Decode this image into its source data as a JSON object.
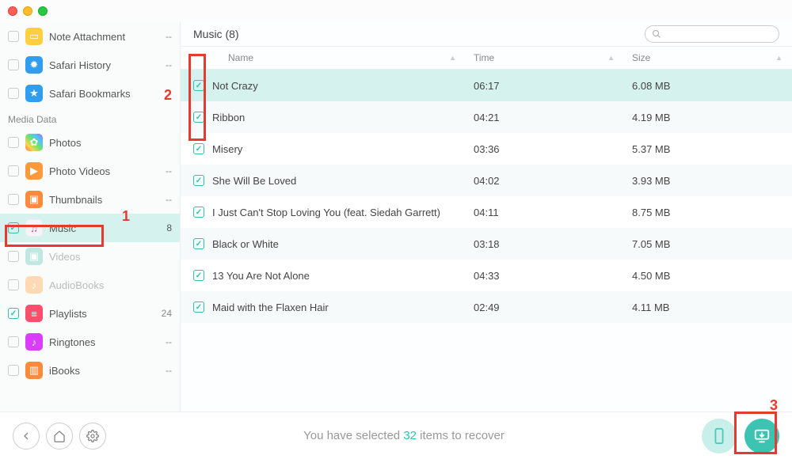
{
  "header": {
    "title": "Music (8)"
  },
  "sidebar": {
    "groups": [
      {
        "label": null,
        "items": [
          {
            "icon": "ic-note",
            "glyph": "▭",
            "label": "Note Attachment",
            "count": "--",
            "checked": false,
            "selected": false,
            "disabled": false
          },
          {
            "icon": "ic-safari",
            "glyph": "✹",
            "label": "Safari History",
            "count": "--",
            "checked": false,
            "selected": false,
            "disabled": false
          },
          {
            "icon": "ic-safari",
            "glyph": "★",
            "label": "Safari Bookmarks",
            "count": "",
            "checked": false,
            "selected": false,
            "disabled": false
          }
        ]
      },
      {
        "label": "Media Data",
        "items": [
          {
            "icon": "ic-photos",
            "glyph": "✿",
            "label": "Photos",
            "count": "",
            "checked": false,
            "selected": false,
            "disabled": false
          },
          {
            "icon": "ic-pvideo",
            "glyph": "▶",
            "label": "Photo Videos",
            "count": "--",
            "checked": false,
            "selected": false,
            "disabled": false
          },
          {
            "icon": "ic-thumb",
            "glyph": "▣",
            "label": "Thumbnails",
            "count": "--",
            "checked": false,
            "selected": false,
            "disabled": false
          },
          {
            "icon": "ic-music",
            "glyph": "♫",
            "label": "Music",
            "count": "8",
            "checked": true,
            "selected": true,
            "disabled": false
          },
          {
            "icon": "ic-videos",
            "glyph": "▣",
            "label": "Videos",
            "count": "",
            "checked": false,
            "selected": false,
            "disabled": true
          },
          {
            "icon": "ic-audio",
            "glyph": "♪",
            "label": "AudioBooks",
            "count": "",
            "checked": false,
            "selected": false,
            "disabled": true
          },
          {
            "icon": "ic-play",
            "glyph": "≡",
            "label": "Playlists",
            "count": "24",
            "checked": true,
            "selected": false,
            "disabled": false
          },
          {
            "icon": "ic-ring",
            "glyph": "♪",
            "label": "Ringtones",
            "count": "--",
            "checked": false,
            "selected": false,
            "disabled": false
          },
          {
            "icon": "ic-ibook",
            "glyph": "▥",
            "label": "iBooks",
            "count": "--",
            "checked": false,
            "selected": false,
            "disabled": false
          }
        ]
      }
    ]
  },
  "table": {
    "cols": {
      "name": "Name",
      "time": "Time",
      "size": "Size"
    },
    "rows": [
      {
        "name": "Not Crazy",
        "time": "06:17",
        "size": "6.08 MB",
        "checked": true,
        "selected": true
      },
      {
        "name": "Ribbon",
        "time": "04:21",
        "size": "4.19 MB",
        "checked": true,
        "selected": false
      },
      {
        "name": "Misery",
        "time": "03:36",
        "size": "5.37 MB",
        "checked": true,
        "selected": false
      },
      {
        "name": "She Will Be Loved",
        "time": "04:02",
        "size": "3.93 MB",
        "checked": true,
        "selected": false
      },
      {
        "name": "I Just Can't Stop Loving You (feat. Siedah Garrett)",
        "time": "04:11",
        "size": "8.75 MB",
        "checked": true,
        "selected": false
      },
      {
        "name": "Black or White",
        "time": "03:18",
        "size": "7.05 MB",
        "checked": true,
        "selected": false
      },
      {
        "name": "13 You Are Not Alone",
        "time": "04:33",
        "size": "4.50 MB",
        "checked": true,
        "selected": false
      },
      {
        "name": "Maid with the Flaxen Hair",
        "time": "02:49",
        "size": "4.11 MB",
        "checked": true,
        "selected": false
      }
    ]
  },
  "footer": {
    "status_pre": "You have selected ",
    "status_count": "32",
    "status_post": " items to recover"
  },
  "annotations": {
    "a1": "1",
    "a2": "2",
    "a3": "3"
  }
}
